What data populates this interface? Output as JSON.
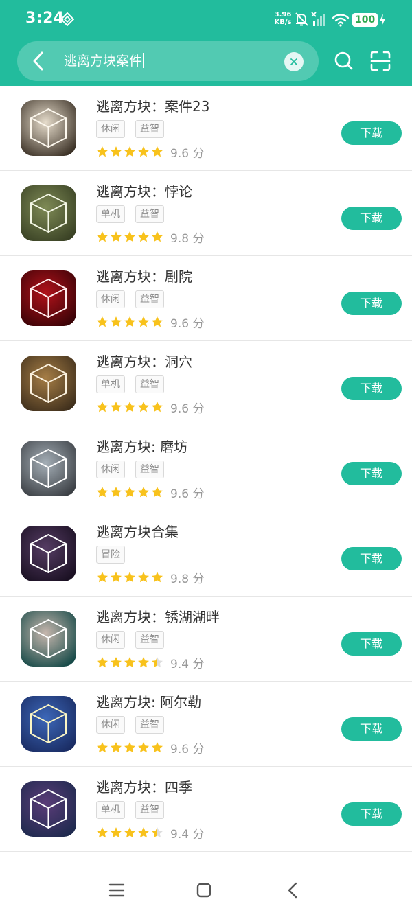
{
  "status_bar": {
    "time": "3:24",
    "net_speed_value": "3.96",
    "net_speed_unit": "KB/s",
    "battery": "100"
  },
  "search": {
    "query": "逃离方块案件"
  },
  "apps": [
    {
      "name": "逃离方块：案件23",
      "tags": [
        "休闲",
        "益智"
      ],
      "rating": 5,
      "score": "9.6 分",
      "download_label": "下载",
      "icon_theme": "case23"
    },
    {
      "name": "逃离方块：悖论",
      "tags": [
        "单机",
        "益智"
      ],
      "rating": 5,
      "score": "9.8 分",
      "download_label": "下载",
      "icon_theme": "paradox"
    },
    {
      "name": "逃离方块：剧院",
      "tags": [
        "休闲",
        "益智"
      ],
      "rating": 5,
      "score": "9.6 分",
      "download_label": "下载",
      "icon_theme": "theatre"
    },
    {
      "name": "逃离方块：洞穴",
      "tags": [
        "单机",
        "益智"
      ],
      "rating": 5,
      "score": "9.6 分",
      "download_label": "下载",
      "icon_theme": "cave"
    },
    {
      "name": "逃离方块: 磨坊",
      "tags": [
        "休闲",
        "益智"
      ],
      "rating": 5,
      "score": "9.6 分",
      "download_label": "下载",
      "icon_theme": "mill"
    },
    {
      "name": "逃离方块合集",
      "tags": [
        "冒险"
      ],
      "rating": 5,
      "score": "9.8 分",
      "download_label": "下载",
      "icon_theme": "collection"
    },
    {
      "name": "逃离方块：锈湖湖畔",
      "tags": [
        "休闲",
        "益智"
      ],
      "rating": 4.5,
      "score": "9.4 分",
      "download_label": "下载",
      "icon_theme": "lake"
    },
    {
      "name": "逃离方块: 阿尔勒",
      "tags": [
        "休闲",
        "益智"
      ],
      "rating": 5,
      "score": "9.6 分",
      "download_label": "下载",
      "icon_theme": "arles"
    },
    {
      "name": "逃离方块：四季",
      "tags": [
        "单机",
        "益智"
      ],
      "rating": 4.5,
      "score": "9.4 分",
      "download_label": "下载",
      "icon_theme": "seasons"
    }
  ],
  "colors": {
    "accent": "#22bc9d",
    "star": "#f8c21c",
    "star_empty": "#dddddd"
  }
}
